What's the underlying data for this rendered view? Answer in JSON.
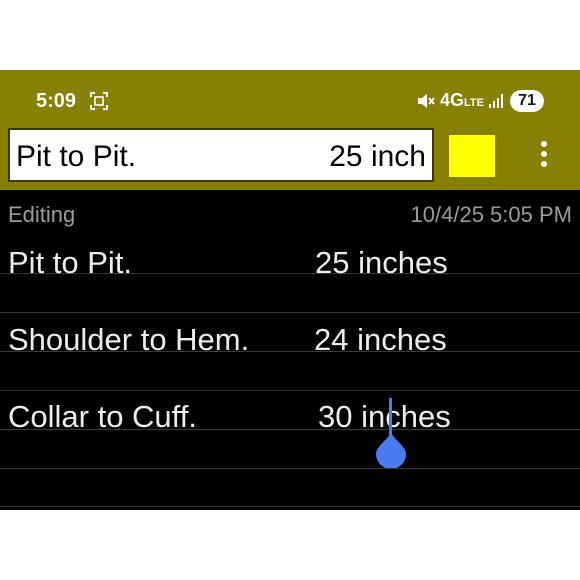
{
  "status_bar": {
    "time": "5:09",
    "network": "4G",
    "network_sub": "LTE",
    "battery": "71",
    "icons": [
      "screenshot-icon",
      "mute-icon",
      "signal-icon"
    ]
  },
  "toolbar": {
    "edit_label": "Pit to Pit.",
    "edit_value": "25 inch",
    "swatch_color": "#ffff00",
    "menu_icon": "more-vert-icon"
  },
  "header": {
    "mode": "Editing",
    "timestamp": "10/4/25 5:05 PM"
  },
  "measurements": [
    {
      "label": "Pit to Pit.",
      "value": "25 inches"
    },
    {
      "label": "Shoulder to Hem.",
      "value": "24 inches"
    },
    {
      "label": "Collar to Cuff.",
      "value": "30 inches"
    }
  ],
  "colors": {
    "appbar": "#868003",
    "background": "#000000",
    "text": "#ededed",
    "cursor": "#4a7cf0"
  }
}
